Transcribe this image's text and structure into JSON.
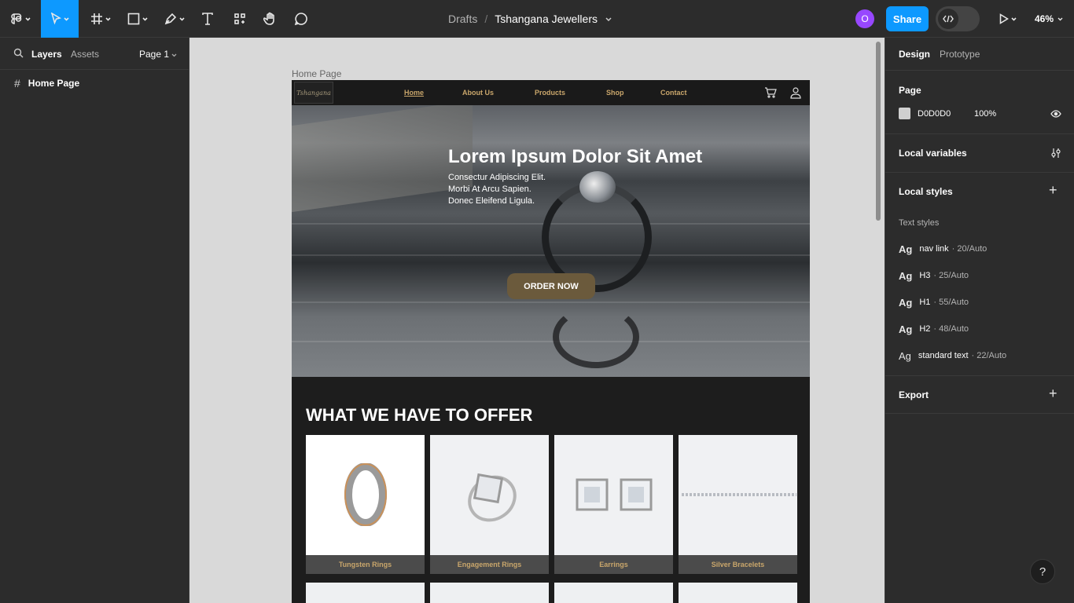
{
  "toolbar": {
    "breadcrumb_drafts": "Drafts",
    "breadcrumb_sep": "/",
    "file_name": "Tshangana Jewellers",
    "avatar_initial": "O",
    "share_label": "Share",
    "zoom": "46%"
  },
  "left_panel": {
    "tab_layers": "Layers",
    "tab_assets": "Assets",
    "page_selector": "Page 1",
    "layers": [
      {
        "label": "Home Page"
      }
    ]
  },
  "canvas": {
    "frame_label": "Home Page",
    "site": {
      "logo_text": "Tshangana",
      "nav": [
        "Home",
        "About Us",
        "Products",
        "Shop",
        "Contact"
      ],
      "hero_title": "Lorem Ipsum Dolor Sit Amet",
      "hero_sub": [
        "Consectur Adipiscing Elit.",
        "Morbi At Arcu Sapien.",
        "Donec Eleifend Ligula."
      ],
      "cta": "ORDER NOW",
      "offer_title": "WHAT WE HAVE TO OFFER",
      "products": [
        {
          "label": "Tungsten Rings"
        },
        {
          "label": "Engagement Rings"
        },
        {
          "label": "Earrings"
        },
        {
          "label": "Silver Bracelets"
        }
      ]
    }
  },
  "right_panel": {
    "tab_design": "Design",
    "tab_prototype": "Prototype",
    "page_heading": "Page",
    "page_color": "D0D0D0",
    "page_opacity": "100%",
    "local_variables": "Local variables",
    "local_styles": "Local styles",
    "text_styles_heading": "Text styles",
    "text_styles": [
      {
        "ag": "Ag",
        "name": "nav link",
        "size": "· 20/Auto"
      },
      {
        "ag": "Ag",
        "name": "H3",
        "size": "· 25/Auto"
      },
      {
        "ag": "Ag",
        "name": "H1",
        "size": "· 55/Auto"
      },
      {
        "ag": "Ag",
        "name": "H2",
        "size": "· 48/Auto"
      },
      {
        "ag": "Ag",
        "name": "standard text",
        "size": "· 22/Auto"
      }
    ],
    "export": "Export"
  },
  "help": "?",
  "colors": {
    "accent": "#0d99ff",
    "gold": "#c9a66b",
    "avatar": "#9747ff"
  }
}
